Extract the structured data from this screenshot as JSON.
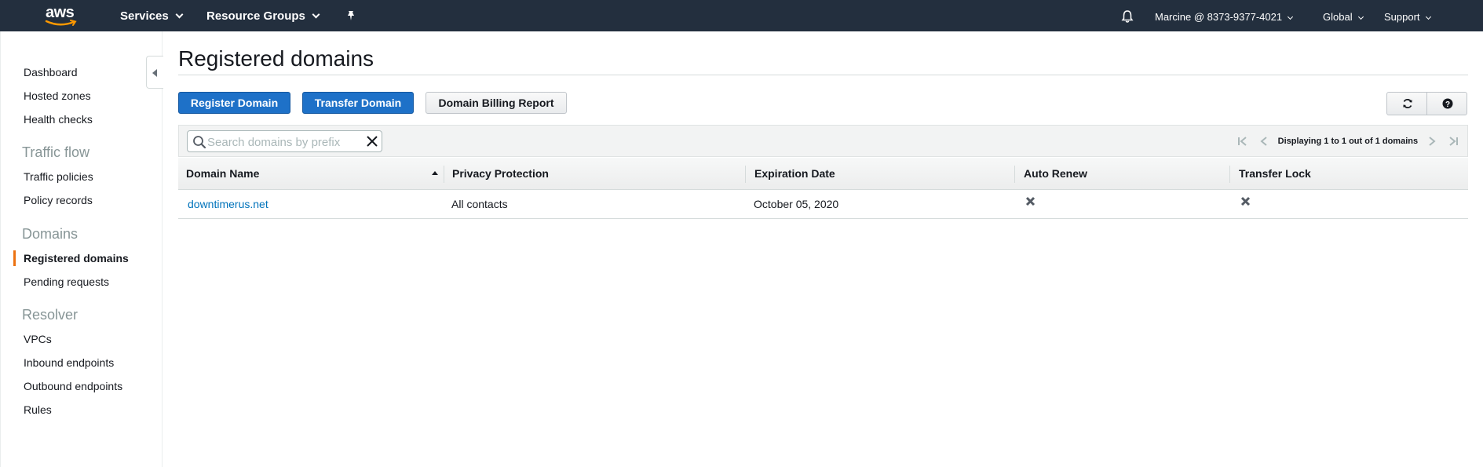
{
  "header": {
    "logo_text": "aws",
    "services_label": "Services",
    "resource_groups_label": "Resource Groups",
    "pin_icon": "pin-icon",
    "bell_icon": "bell-icon",
    "account_label": "Marcine @ 8373-9377-4021",
    "region_label": "Global",
    "support_label": "Support",
    "bg_color": "#232f3e"
  },
  "sidebar": {
    "collapse_icon": "collapse-left-icon",
    "top_links": [
      {
        "label": "Dashboard"
      },
      {
        "label": "Hosted zones"
      },
      {
        "label": "Health checks"
      }
    ],
    "sections": [
      {
        "heading": "Traffic flow",
        "items": [
          {
            "label": "Traffic policies"
          },
          {
            "label": "Policy records"
          }
        ]
      },
      {
        "heading": "Domains",
        "items": [
          {
            "label": "Registered domains",
            "active": true
          },
          {
            "label": "Pending requests"
          }
        ]
      },
      {
        "heading": "Resolver",
        "items": [
          {
            "label": "VPCs"
          },
          {
            "label": "Inbound endpoints"
          },
          {
            "label": "Outbound endpoints"
          },
          {
            "label": "Rules"
          }
        ]
      }
    ],
    "active_color": "#ec7211"
  },
  "main": {
    "title": "Registered domains",
    "buttons": {
      "register": "Register Domain",
      "transfer": "Transfer Domain",
      "billing": "Domain Billing Report"
    },
    "refresh_icon": "refresh-icon",
    "help_icon": "help-icon",
    "search": {
      "placeholder": "Search domains by prefix",
      "value": ""
    },
    "pager_text": "Displaying 1 to 1 out of 1 domains",
    "table": {
      "columns": [
        "Domain Name",
        "Privacy Protection",
        "Expiration Date",
        "Auto Renew",
        "Transfer Lock"
      ],
      "sort_column": "Domain Name",
      "sort_direction": "ascending",
      "rows": [
        {
          "domain": "downtimerus.net",
          "privacy": "All contacts",
          "expiration": "October 05, 2020",
          "auto_renew": "disabled",
          "transfer_lock": "disabled"
        }
      ]
    },
    "primary_color": "#1e71c8",
    "link_color": "#0073bb"
  }
}
